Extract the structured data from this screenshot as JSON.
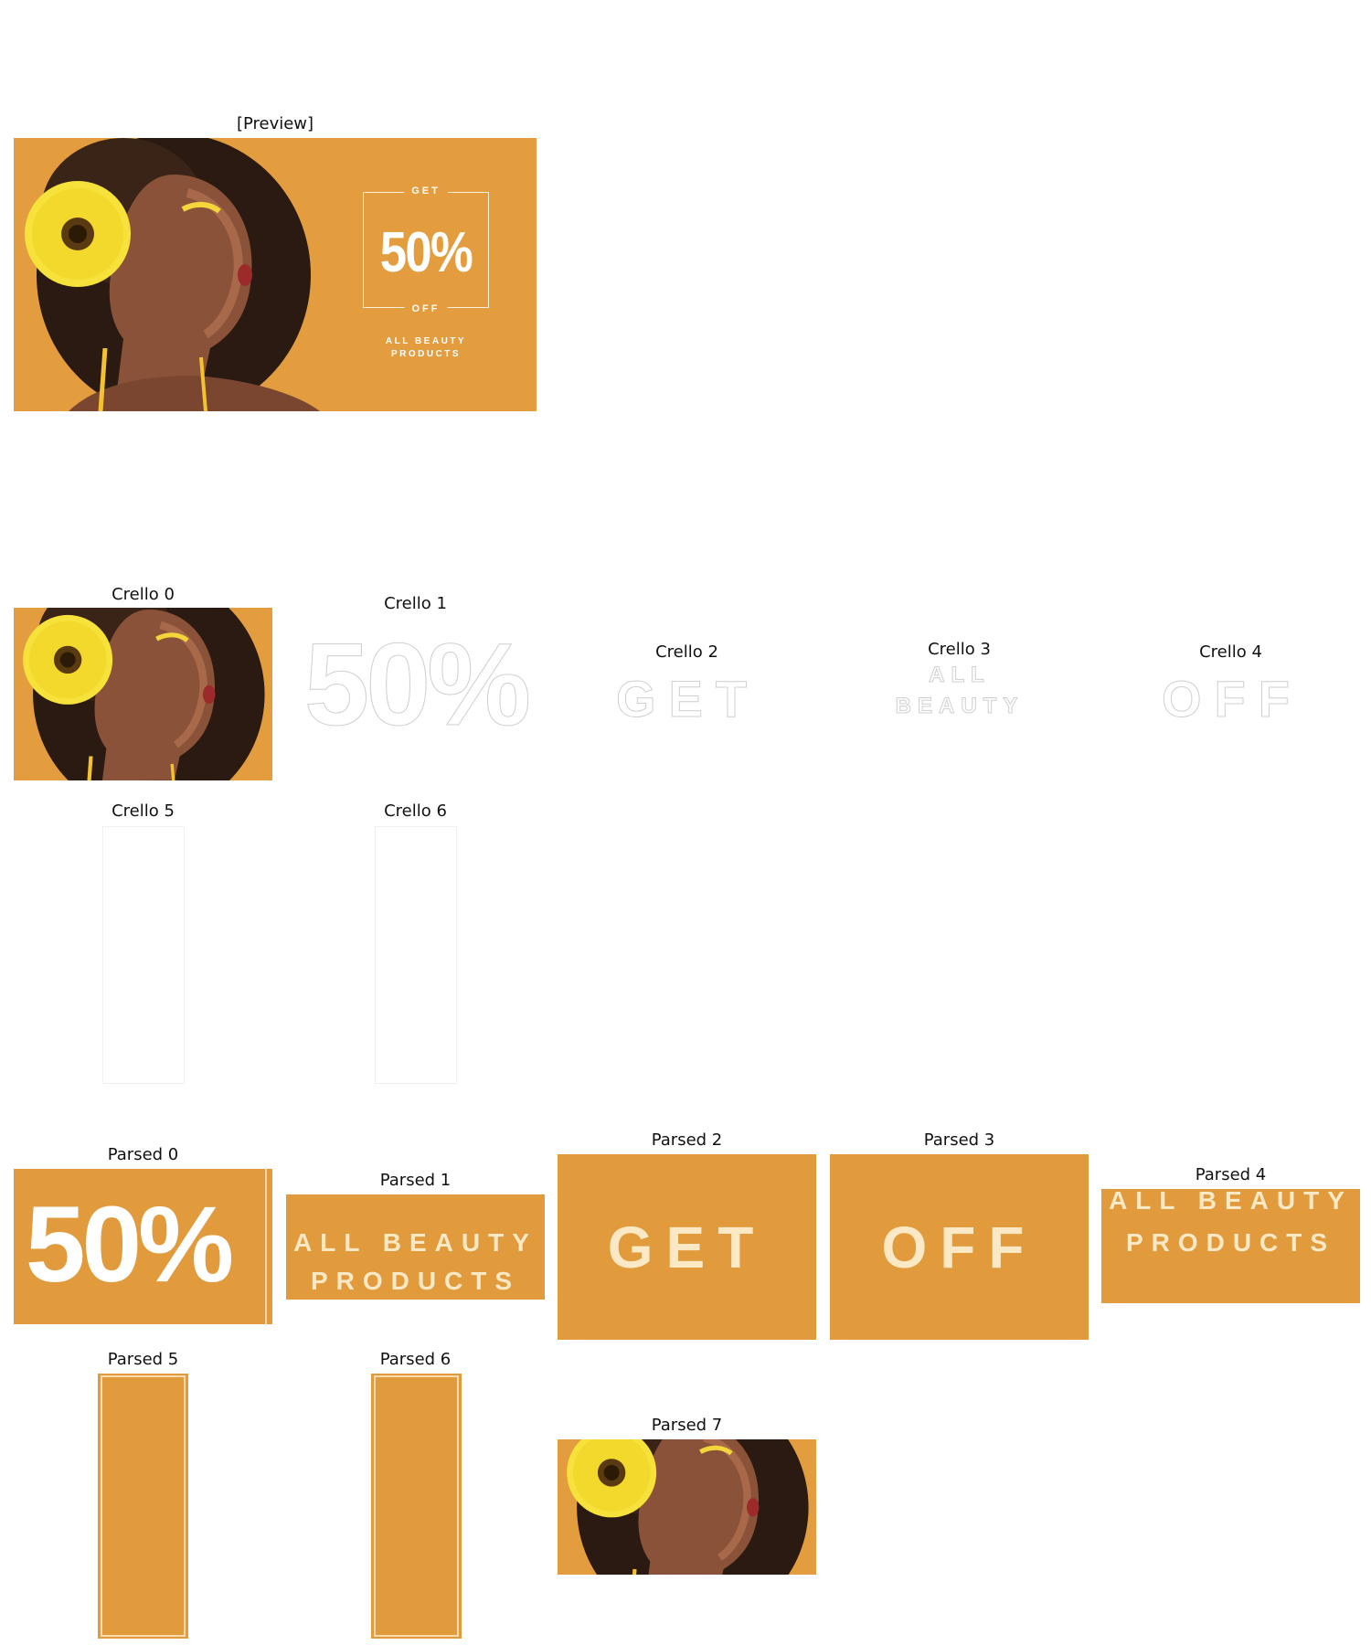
{
  "captions": {
    "preview": "[Preview]",
    "crello_0": "Crello 0",
    "crello_1": "Crello 1",
    "crello_2": "Crello 2",
    "crello_3": "Crello 3",
    "crello_4": "Crello 4",
    "crello_5": "Crello 5",
    "crello_6": "Crello 6",
    "parsed_0": "Parsed 0",
    "parsed_1": "Parsed 1",
    "parsed_2": "Parsed 2",
    "parsed_3": "Parsed 3",
    "parsed_4": "Parsed 4",
    "parsed_5": "Parsed 5",
    "parsed_6": "Parsed 6",
    "parsed_7": "Parsed 7"
  },
  "ad": {
    "get": "GET",
    "percent": "50%",
    "off": "OFF",
    "line1": "ALL BEAUTY",
    "line2": "PRODUCTS"
  },
  "colors": {
    "ad_background": "#e39d3f",
    "text": "#ffffff"
  }
}
